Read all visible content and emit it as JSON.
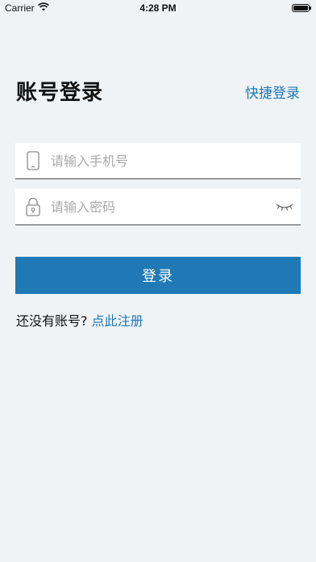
{
  "status_bar": {
    "carrier": "Carrier",
    "time": "4:28 PM"
  },
  "header": {
    "title": "账号登录",
    "quick_login": "快捷登录"
  },
  "form": {
    "phone_placeholder": "请输入手机号",
    "password_placeholder": "请输入密码",
    "login_label": "登录"
  },
  "register": {
    "prompt": "还没有账号?",
    "link": "点此注册"
  },
  "colors": {
    "accent": "#1e79b5",
    "background": "#eff3f6"
  }
}
